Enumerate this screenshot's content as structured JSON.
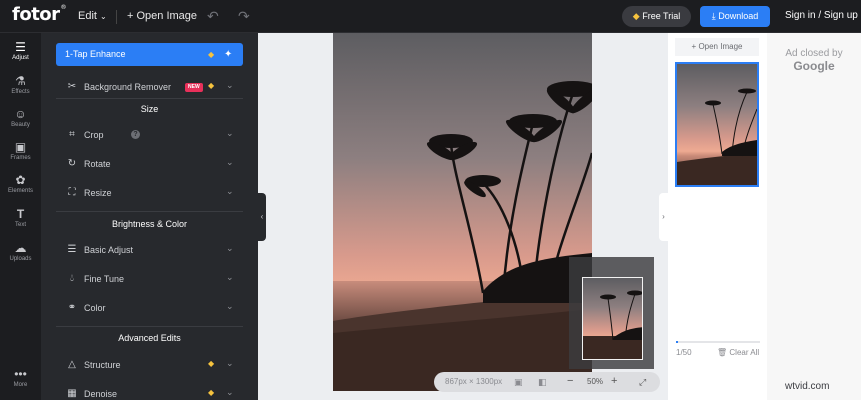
{
  "topbar": {
    "logo": "fotor",
    "logo_mark": "®",
    "edit_label": "Edit",
    "open_image_label": "Open Image",
    "free_trial_label": "Free Trial",
    "download_label": "Download",
    "signin_label": "Sign in / Sign up"
  },
  "rail": {
    "items": [
      {
        "label": "Adjust",
        "icon": "sliders-icon"
      },
      {
        "label": "Effects",
        "icon": "flask-icon"
      },
      {
        "label": "Beauty",
        "icon": "face-icon"
      },
      {
        "label": "Frames",
        "icon": "frame-icon"
      },
      {
        "label": "Elements",
        "icon": "shapes-icon"
      },
      {
        "label": "Text",
        "icon": "text-icon"
      },
      {
        "label": "Uploads",
        "icon": "cloud-upload-icon"
      },
      {
        "label": "More",
        "icon": "more-dots-icon"
      }
    ]
  },
  "panel": {
    "enhance_label": "1-Tap Enhance",
    "background_remover_label": "Background Remover",
    "new_badge": "NEW",
    "size_heading": "Size",
    "crop_label": "Crop",
    "rotate_label": "Rotate",
    "resize_label": "Resize",
    "brightness_heading": "Brightness & Color",
    "basic_adjust_label": "Basic Adjust",
    "fine_tune_label": "Fine Tune",
    "color_label": "Color",
    "advanced_heading": "Advanced Edits",
    "structure_label": "Structure",
    "denoise_label": "Denoise"
  },
  "canvas": {
    "dimensions": "867px × 1300px",
    "zoom": "50%"
  },
  "right_panel": {
    "open_image_label": "Open Image",
    "count": "1/50",
    "clear_all_label": "Clear All",
    "progress": 0.02
  },
  "ad": {
    "line1": "Ad closed by",
    "line2": "Google"
  },
  "watermark": "wtvid.com",
  "colors": {
    "accent": "#2b7ef5",
    "premium": "#f6c33e",
    "new_badge": "#e8305a"
  }
}
